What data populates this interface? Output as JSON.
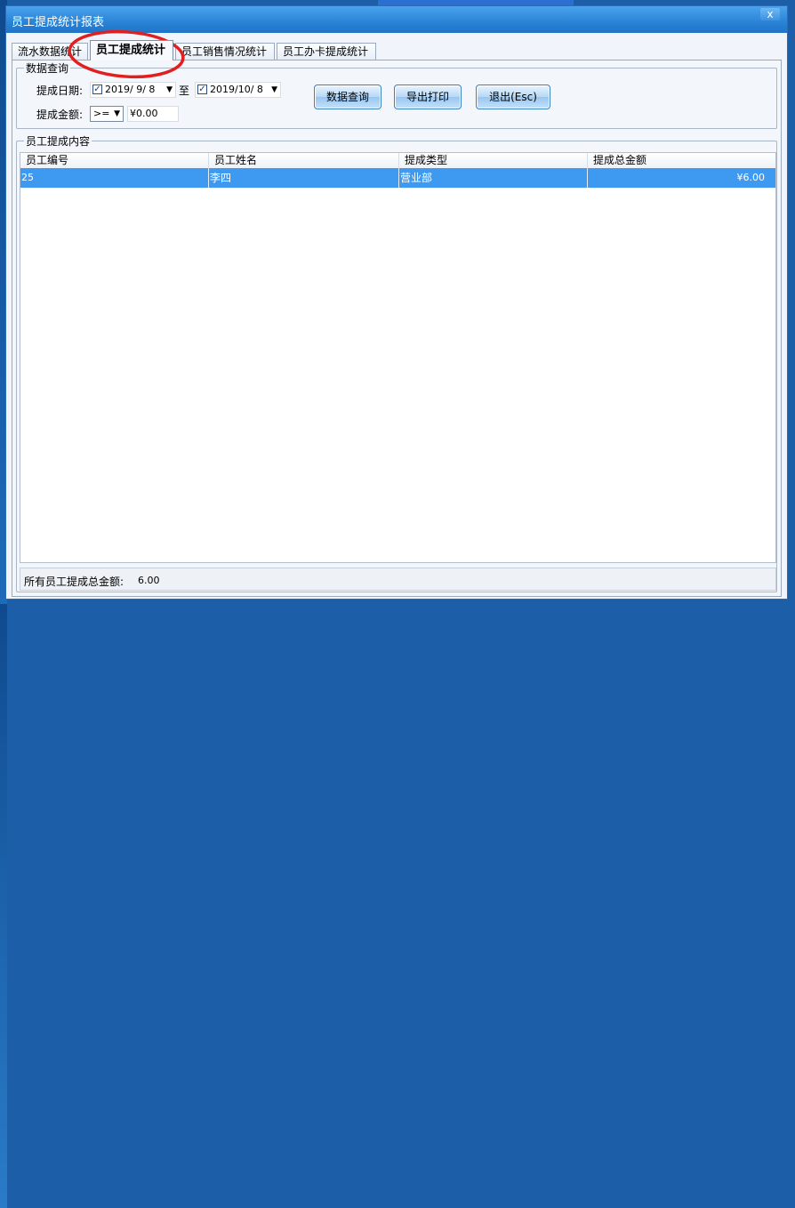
{
  "window": {
    "title": "员工提成统计报表",
    "close_label": "x"
  },
  "tabs": [
    {
      "label": "流水数据统计"
    },
    {
      "label": "员工提成统计",
      "active": true
    },
    {
      "label": "员工销售情况统计"
    },
    {
      "label": "员工办卡提成统计"
    }
  ],
  "query": {
    "group_title": "数据查询",
    "date_label": "提成日期:",
    "date_from": "2019/ 9/ 8",
    "to_label": "至",
    "date_to": "2019/10/ 8",
    "amount_label": "提成金额:",
    "operator": ">=",
    "amount_value": "¥0.00",
    "buttons": {
      "query": "数据查询",
      "export": "导出打印",
      "exit": "退出(Esc)"
    }
  },
  "content": {
    "group_title": "员工提成内容",
    "columns": [
      "员工编号",
      "员工姓名",
      "提成类型",
      "提成总金额"
    ],
    "rows": [
      {
        "id": "25",
        "name": "李四",
        "type": "营业部",
        "amount": "¥6.00"
      }
    ]
  },
  "footer": {
    "total_label": "所有员工提成总金额:",
    "total_value": "6.00"
  },
  "colors": {
    "selection": "#3d9af0",
    "titlebar": "#2a83d6",
    "annotation": "#e02020"
  }
}
